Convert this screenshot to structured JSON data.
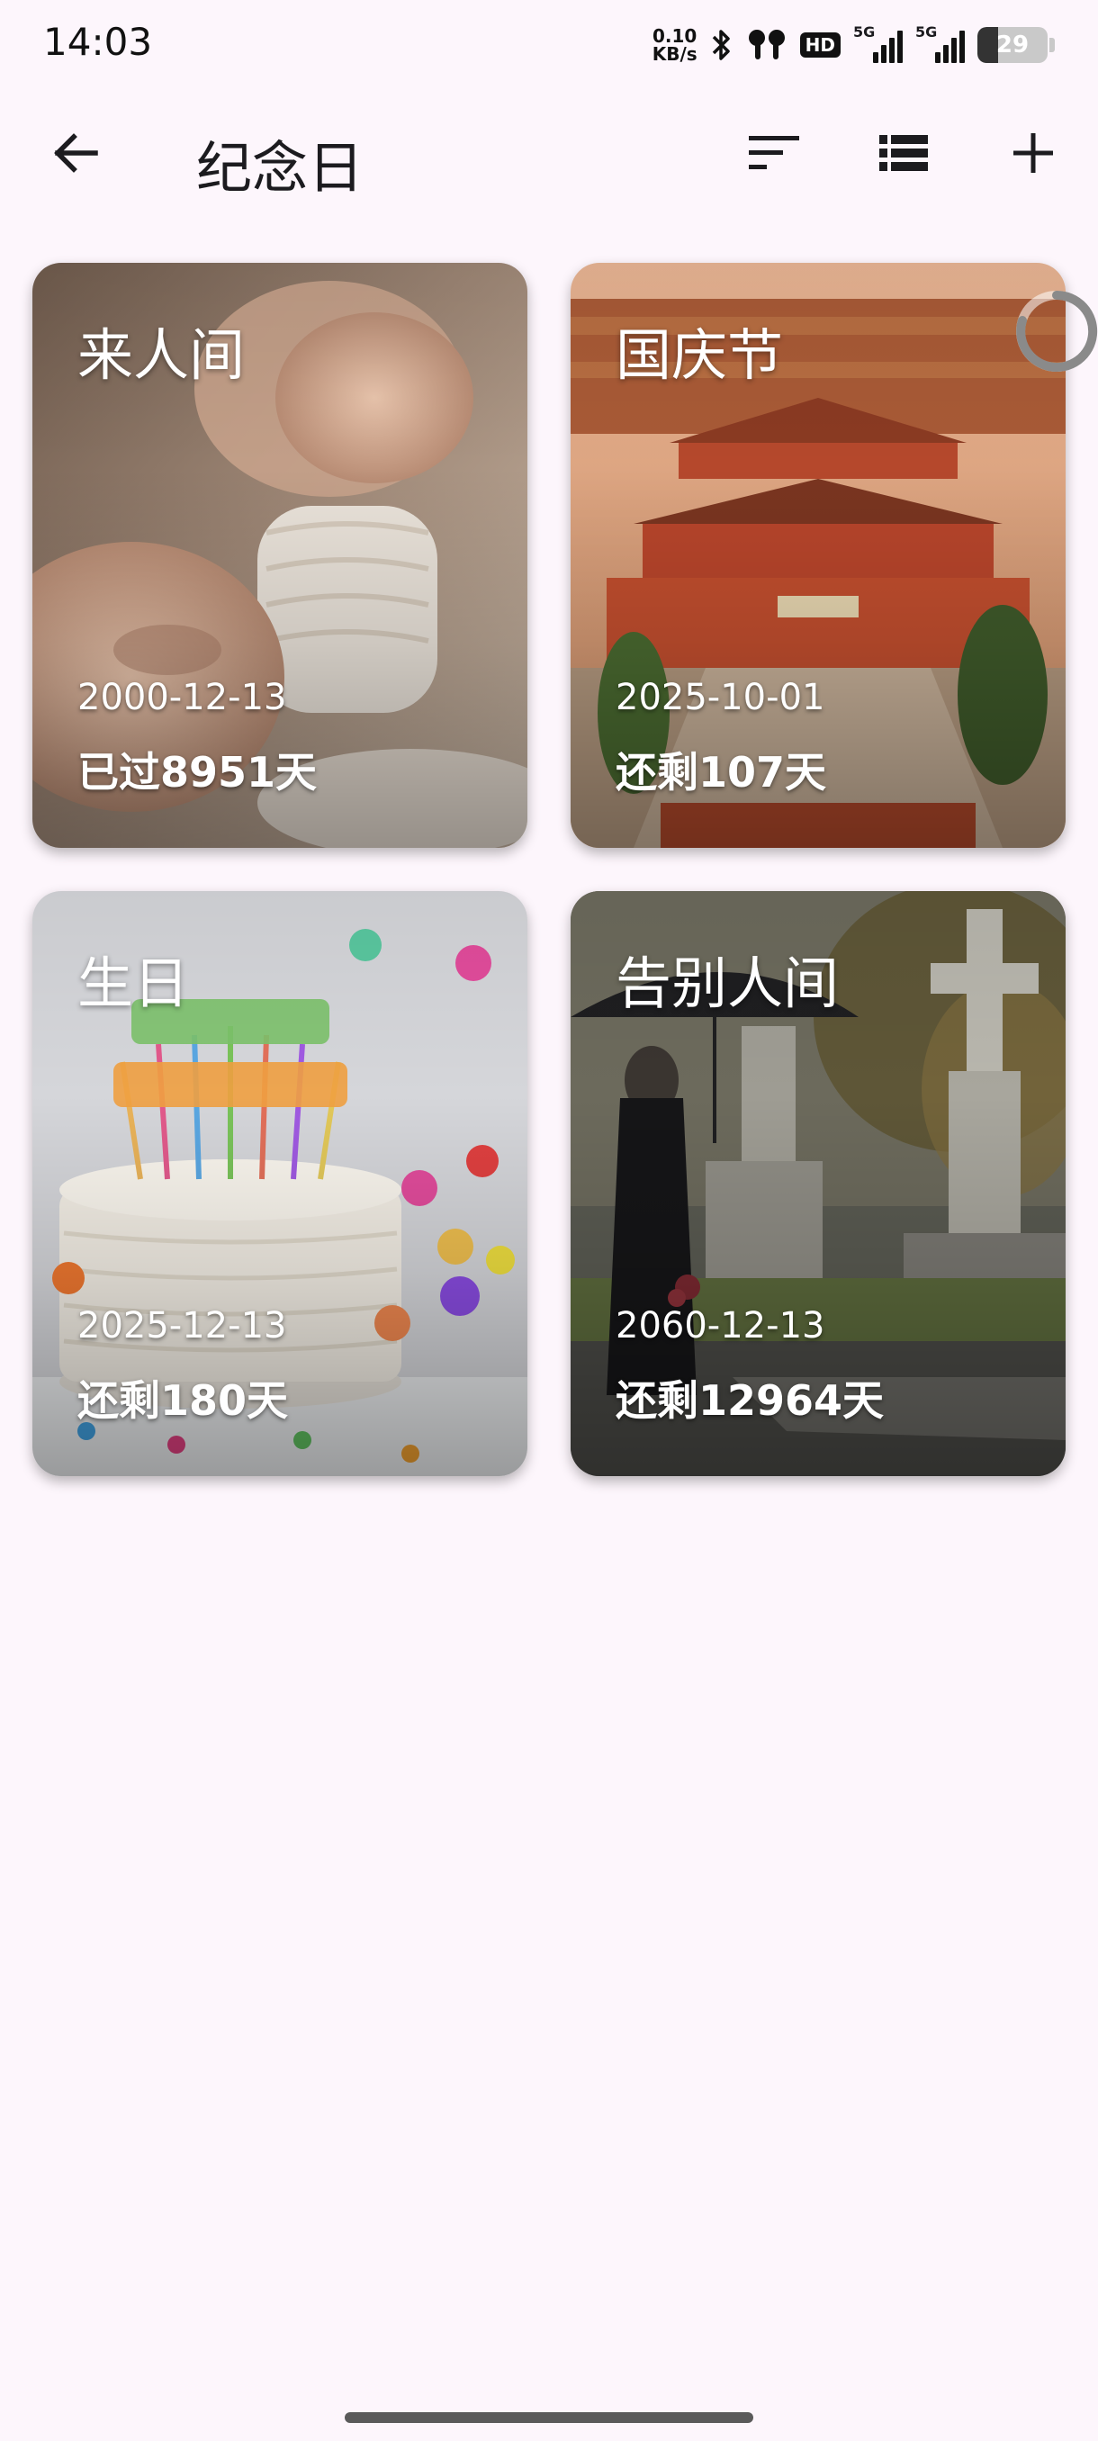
{
  "status_bar": {
    "time": "14:03",
    "net_speed_value": "0.10",
    "net_speed_unit": "KB/s",
    "hd_label": "HD",
    "sim1_label": "5G",
    "sim2_label": "5G",
    "battery_percent": "29",
    "icons": [
      "bluetooth-icon",
      "earbuds-icon",
      "hd-icon",
      "signal-icon",
      "battery-icon"
    ]
  },
  "app_bar": {
    "title": "纪念日",
    "icons": [
      "back-arrow-icon",
      "sort-icon",
      "list-view-icon",
      "add-icon"
    ]
  },
  "cards": [
    {
      "title": "来人间",
      "date": "2000-12-13",
      "count": "已过8951天",
      "image": "baby-hand-photo"
    },
    {
      "title": "国庆节",
      "date": "2025-10-01",
      "count": "还剩107天",
      "image": "forbidden-city-photo"
    },
    {
      "title": "生日",
      "date": "2025-12-13",
      "count": "还剩180天",
      "image": "birthday-cake-photo"
    },
    {
      "title": "告别人间",
      "date": "2060-12-13",
      "count": "还剩12964天",
      "image": "cemetery-photo"
    }
  ],
  "colors": {
    "background": "#FDF6FC",
    "card_text": "#FFFFFF",
    "icon": "#1C1B1F"
  }
}
